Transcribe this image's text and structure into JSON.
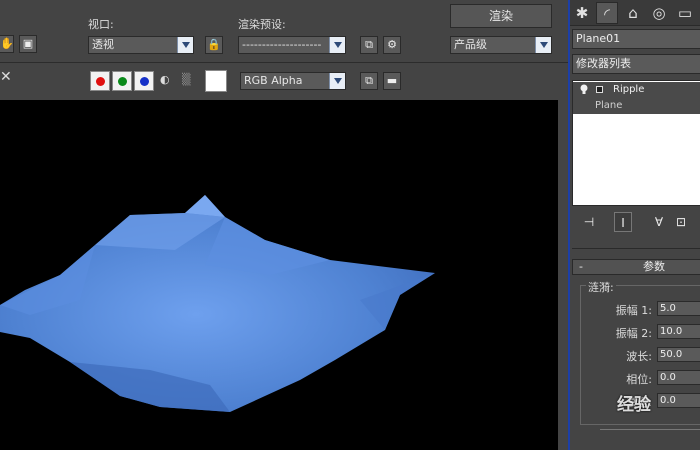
{
  "toolbar": {
    "viewport_label": "视口:",
    "viewport_value": "透视",
    "preset_label": "渲染预设:",
    "preset_value": "--------------------",
    "render_button": "渲染",
    "quality_value": "产品级",
    "channel_value": "RGB Alpha",
    "close_glyph": "✕"
  },
  "colors": {
    "red": "#e01010",
    "green": "#0a8a1a",
    "blue": "#1530c8",
    "mesh": "#5a8ad8",
    "panel_border": "#1c3fa8"
  },
  "command_panel": {
    "tabs": [
      "✱",
      "◜",
      "⌂",
      "◎",
      "▭"
    ],
    "object_name": "Plane01",
    "modifier_list": "修改器列表",
    "stack": [
      {
        "name": "Ripple",
        "type": "modifier"
      },
      {
        "name": "Plane",
        "type": "base"
      }
    ],
    "stack_tools": [
      "⊣",
      "I",
      "∀",
      "⊡"
    ],
    "rollout_title": "参数",
    "group_label": "涟漪:",
    "params": [
      {
        "label": "振幅 1:",
        "value": "5.0"
      },
      {
        "label": "振幅 2:",
        "value": "10.0"
      },
      {
        "label": "波长:",
        "value": "50.0"
      },
      {
        "label": "相位:",
        "value": "0.0"
      },
      {
        "label": "衰退:",
        "value": "0.0"
      }
    ]
  },
  "watermark": "经验"
}
